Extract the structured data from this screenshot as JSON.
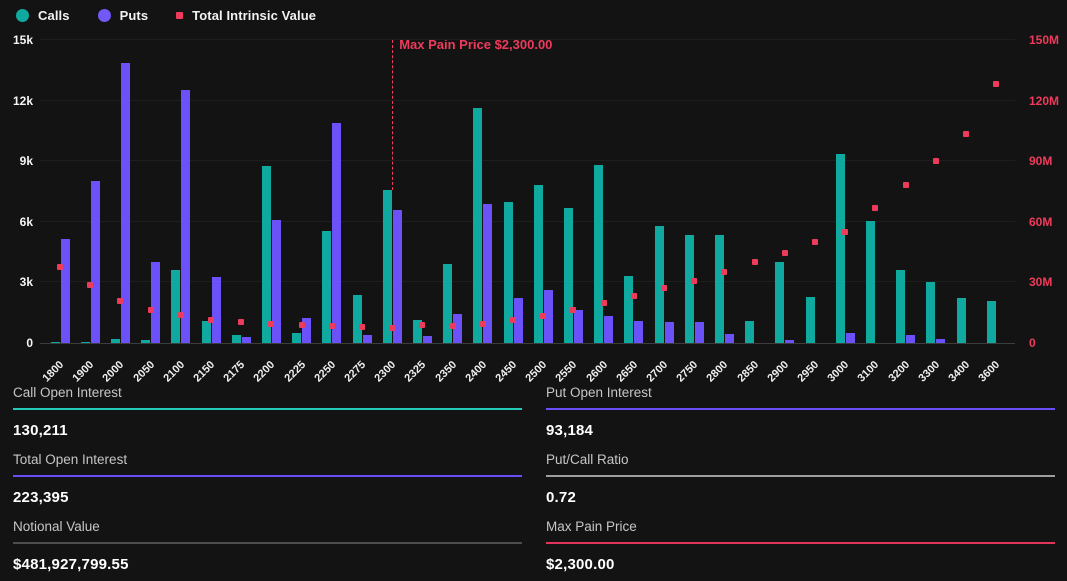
{
  "legend": {
    "items": [
      {
        "label": "Calls",
        "color": "#0fa99f",
        "shape": "circle"
      },
      {
        "label": "Puts",
        "color": "#7258f5",
        "shape": "circle"
      },
      {
        "label": "Total Intrinsic Value",
        "color": "#ee3b5c",
        "shape": "square"
      }
    ]
  },
  "chart_data": {
    "type": "bar",
    "subtype": "grouped bars with scatter overlay, dual y-axis",
    "categories": [
      "1800",
      "1900",
      "2000",
      "2050",
      "2100",
      "2150",
      "2175",
      "2200",
      "2225",
      "2250",
      "2275",
      "2300",
      "2325",
      "2350",
      "2400",
      "2450",
      "2500",
      "2550",
      "2600",
      "2650",
      "2700",
      "2750",
      "2800",
      "2850",
      "2900",
      "2950",
      "3000",
      "3100",
      "3200",
      "3300",
      "3400",
      "3600"
    ],
    "series": [
      {
        "name": "Calls",
        "type": "bar",
        "axis": "left",
        "color": "#0fa99f",
        "values": [
          40,
          60,
          200,
          150,
          3600,
          1100,
          380,
          8750,
          500,
          5550,
          2370,
          7570,
          1140,
          3900,
          11650,
          7000,
          7800,
          6700,
          8800,
          3320,
          5800,
          5350,
          5350,
          1100,
          4000,
          2260,
          9350,
          6050,
          3600,
          3030,
          2240,
          2090
        ]
      },
      {
        "name": "Puts",
        "type": "bar",
        "axis": "left",
        "color": "#6b51f8",
        "values": [
          5160,
          8000,
          13840,
          4000,
          12550,
          3260,
          300,
          6080,
          1250,
          10900,
          380,
          6580,
          350,
          1450,
          6880,
          2230,
          2620,
          1630,
          1340,
          1100,
          1020,
          1020,
          450,
          0,
          150,
          0,
          510,
          0,
          400,
          200,
          0,
          0
        ]
      },
      {
        "name": "Total Intrinsic Value",
        "type": "scatter",
        "axis": "right",
        "color": "#ee3b5c",
        "unit": "M",
        "values": [
          37.5,
          28.5,
          20.8,
          16.3,
          13.7,
          11.2,
          10.4,
          9.3,
          8.9,
          8.4,
          7.8,
          7.5,
          8.9,
          8.6,
          9.6,
          11.4,
          13.4,
          16.3,
          19.6,
          23.3,
          27.1,
          30.8,
          35.1,
          40.2,
          44.7,
          50.1,
          55.1,
          66.7,
          78.2,
          90.2,
          103.3,
          128.2
        ]
      }
    ],
    "left_axis": {
      "max": 15000,
      "ticks": [
        "0",
        "3k",
        "6k",
        "9k",
        "12k",
        "15k"
      ]
    },
    "right_axis": {
      "max": 150,
      "ticks": [
        "0",
        "30M",
        "60M",
        "90M",
        "120M",
        "150M"
      ]
    },
    "grid": true,
    "legend_position": "top-left",
    "annotation": {
      "label": "Max Pain Price $2,300.00",
      "category": "2300",
      "color": "#ee3b5c"
    }
  },
  "stats": {
    "left": [
      {
        "label": "Call Open Interest",
        "value": "130,211",
        "color": "#22c9b6"
      },
      {
        "label": "Total Open Interest",
        "value": "223,395",
        "color": "#6a4df7"
      },
      {
        "label": "Notional Value",
        "value": "$481,927,799.55",
        "color": "#4d4d4d"
      }
    ],
    "right": [
      {
        "label": "Put Open Interest",
        "value": "93,184",
        "color": "#6a4df7"
      },
      {
        "label": "Put/Call Ratio",
        "value": "0.72",
        "color": "#9e9e9e"
      },
      {
        "label": "Max Pain Price",
        "value": "$2,300.00",
        "color": "#e3335b"
      }
    ]
  }
}
